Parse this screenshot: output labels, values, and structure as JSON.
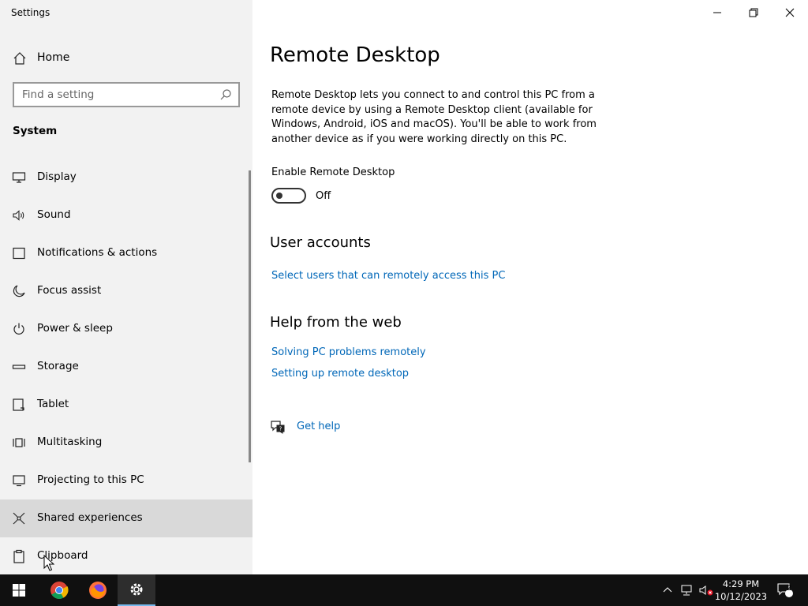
{
  "window": {
    "app_title": "Settings"
  },
  "sidebar": {
    "home_label": "Home",
    "search_placeholder": "Find a setting",
    "section_title": "System",
    "items": [
      {
        "label": "Display",
        "icon": "monitor-icon"
      },
      {
        "label": "Sound",
        "icon": "speaker-icon"
      },
      {
        "label": "Notifications & actions",
        "icon": "notification-icon"
      },
      {
        "label": "Focus assist",
        "icon": "moon-icon"
      },
      {
        "label": "Power & sleep",
        "icon": "power-icon"
      },
      {
        "label": "Storage",
        "icon": "storage-icon"
      },
      {
        "label": "Tablet",
        "icon": "tablet-icon"
      },
      {
        "label": "Multitasking",
        "icon": "multitasking-icon"
      },
      {
        "label": "Projecting to this PC",
        "icon": "projecting-icon"
      },
      {
        "label": "Shared experiences",
        "icon": "shared-experiences-icon",
        "selected": true
      },
      {
        "label": "Clipboard",
        "icon": "clipboard-icon"
      }
    ]
  },
  "main": {
    "title": "Remote Desktop",
    "description": "Remote Desktop lets you connect to and control this PC from a remote device by using a Remote Desktop client (available for Windows, Android, iOS and macOS). You'll be able to work from another device as if you were working directly on this PC.",
    "enable_label": "Enable Remote Desktop",
    "toggle_state": "Off",
    "user_accounts_heading": "User accounts",
    "select_users_link": "Select users that can remotely access this PC",
    "help_heading": "Help from the web",
    "help_links": [
      "Solving PC problems remotely",
      "Setting up remote desktop"
    ],
    "get_help_label": "Get help"
  },
  "taskbar": {
    "apps": [
      "start-icon",
      "chrome-icon",
      "firefox-icon",
      "settings-icon"
    ],
    "time": "4:29 PM",
    "date": "10/12/2023",
    "notification_count": "2"
  },
  "colors": {
    "link": "#0067b8",
    "sidebar_bg": "#f2f2f2",
    "selected_bg": "#d9d9d9",
    "taskbar_bg": "#101010"
  }
}
